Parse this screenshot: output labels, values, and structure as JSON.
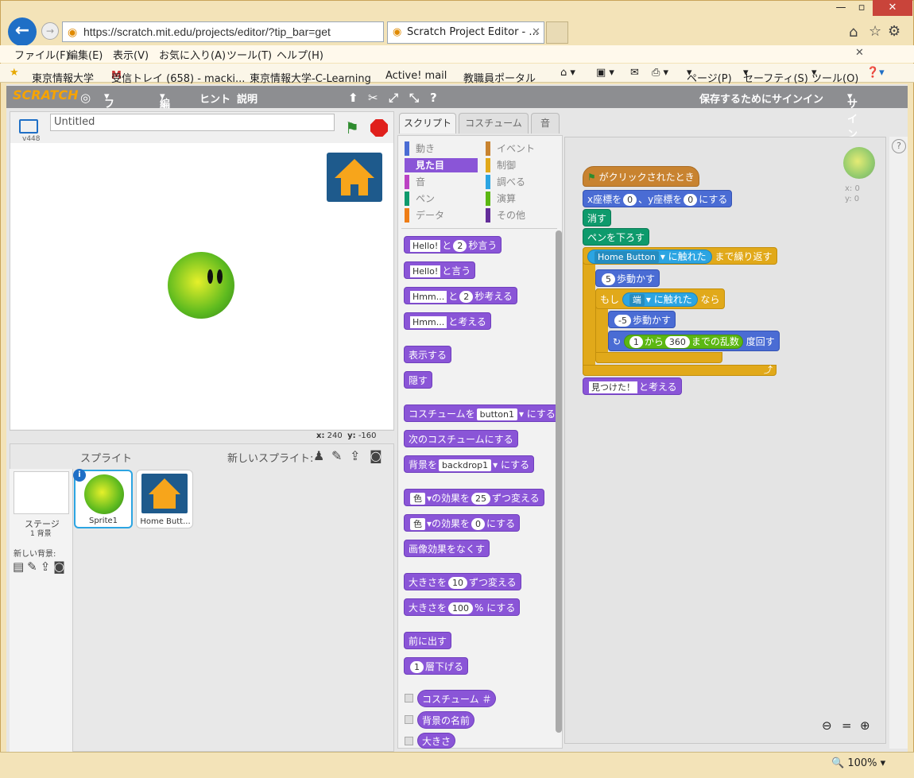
{
  "browser": {
    "address": "https://scratch.mit.edu/projects/editor/?tip_bar=get",
    "tab_title": "Scratch Project Editor - ...",
    "menu": [
      "ファイル(F)",
      "編集(E)",
      "表示(V)",
      "お気に入り(A)",
      "ツール(T)",
      "ヘルプ(H)"
    ],
    "favorites": [
      "東京情報大学",
      "受信トレイ (658) - macki...",
      "東京情報大学-C-Learning",
      "Active! mail",
      "教職員ポータル"
    ],
    "cmd_items": [
      "ページ(P)",
      "セーフティ(S)",
      "ツール(O)"
    ],
    "zoom": "100%"
  },
  "scratch": {
    "logo": "SCRATCH",
    "menu": [
      "ファイル",
      "編集",
      "ヒント",
      "説明"
    ],
    "save_signin": "保存するためにサインイン",
    "signin": "サインイン",
    "version": "v448",
    "project_title": "Untitled",
    "stage_coords": {
      "x_label": "x:",
      "x": "240",
      "y_label": "y:",
      "y": "-160"
    },
    "sprites_label": "スプライト",
    "new_sprite_label": "新しいスプライト:",
    "stage_label": "ステージ",
    "backdrop_count": "1 背景",
    "new_backdrop_label": "新しい背景:",
    "sprites": [
      {
        "name": "Sprite1"
      },
      {
        "name": "Home Butt..."
      }
    ],
    "tabs": [
      "スクリプト",
      "コスチューム",
      "音"
    ],
    "categories": {
      "left": [
        "動き",
        "見た目",
        "音",
        "ペン",
        "データ"
      ],
      "right": [
        "イベント",
        "制御",
        "調べる",
        "演算",
        "その他"
      ],
      "left_colors": [
        "#4a6cd4",
        "#8a55d7",
        "#bb42c3",
        "#0e9a6c",
        "#ee7d16"
      ],
      "right_colors": [
        "#c88330",
        "#e1a91a",
        "#2ca5e2",
        "#5cb712",
        "#632d99"
      ]
    },
    "palette": {
      "say_secs": {
        "msg": "Hello!",
        "mid": "と",
        "secs": "2",
        "suffix": "秒言う"
      },
      "say": {
        "msg": "Hello!",
        "suffix": "と言う"
      },
      "think_secs": {
        "msg": "Hmm...",
        "mid": "と",
        "secs": "2",
        "suffix": "秒考える"
      },
      "think": {
        "msg": "Hmm...",
        "suffix": "と考える"
      },
      "show": "表示する",
      "hide": "隠す",
      "switch_costume": {
        "prefix": "コスチュームを",
        "val": "button1",
        "suffix": "にする"
      },
      "next_costume": "次のコスチュームにする",
      "switch_backdrop": {
        "prefix": "背景を",
        "val": "backdrop1",
        "suffix": "にする"
      },
      "change_effect": {
        "eff": "色",
        "mid": "の効果を",
        "val": "25",
        "suffix": "ずつ変える"
      },
      "set_effect": {
        "eff": "色",
        "mid": "の効果を",
        "val": "0",
        "suffix": "にする"
      },
      "clear_effects": "画像効果をなくす",
      "change_size": {
        "prefix": "大きさを",
        "val": "10",
        "suffix": "ずつ変える"
      },
      "set_size": {
        "prefix": "大きさを",
        "val": "100",
        "suffix": "% にする"
      },
      "front": "前に出す",
      "back_layers": {
        "val": "1",
        "suffix": "層下げる"
      },
      "rep_costume": "コスチューム ＃",
      "rep_backdrop": "背景の名前",
      "rep_size": "大きさ"
    },
    "script": {
      "hat": "がクリックされたとき",
      "goto": {
        "prefix": "x座標を",
        "x": "0",
        "mid": "、y座標を",
        "y": "0",
        "suffix": "にする"
      },
      "clear": "消す",
      "pendown": "ペンを下ろす",
      "until": {
        "sensor": "Home Button",
        "mid": "に触れた",
        "suffix": "まで繰り返す"
      },
      "move1": {
        "val": "5",
        "suffix": "歩動かす"
      },
      "if": {
        "prefix": "もし",
        "sensor": "端",
        "mid": "に触れた",
        "suffix": "なら"
      },
      "move2": {
        "val": "-5",
        "suffix": "歩動かす"
      },
      "turn": {
        "from": "1",
        "mid": "から",
        "to": "360",
        "mid2": "までの乱数",
        "suffix": "度回す"
      },
      "think": {
        "msg": "見つけた！",
        "suffix": "と考える"
      }
    },
    "sprite_pos": {
      "x_label": "x:",
      "x": "0",
      "y_label": "y:",
      "y": "0"
    }
  }
}
